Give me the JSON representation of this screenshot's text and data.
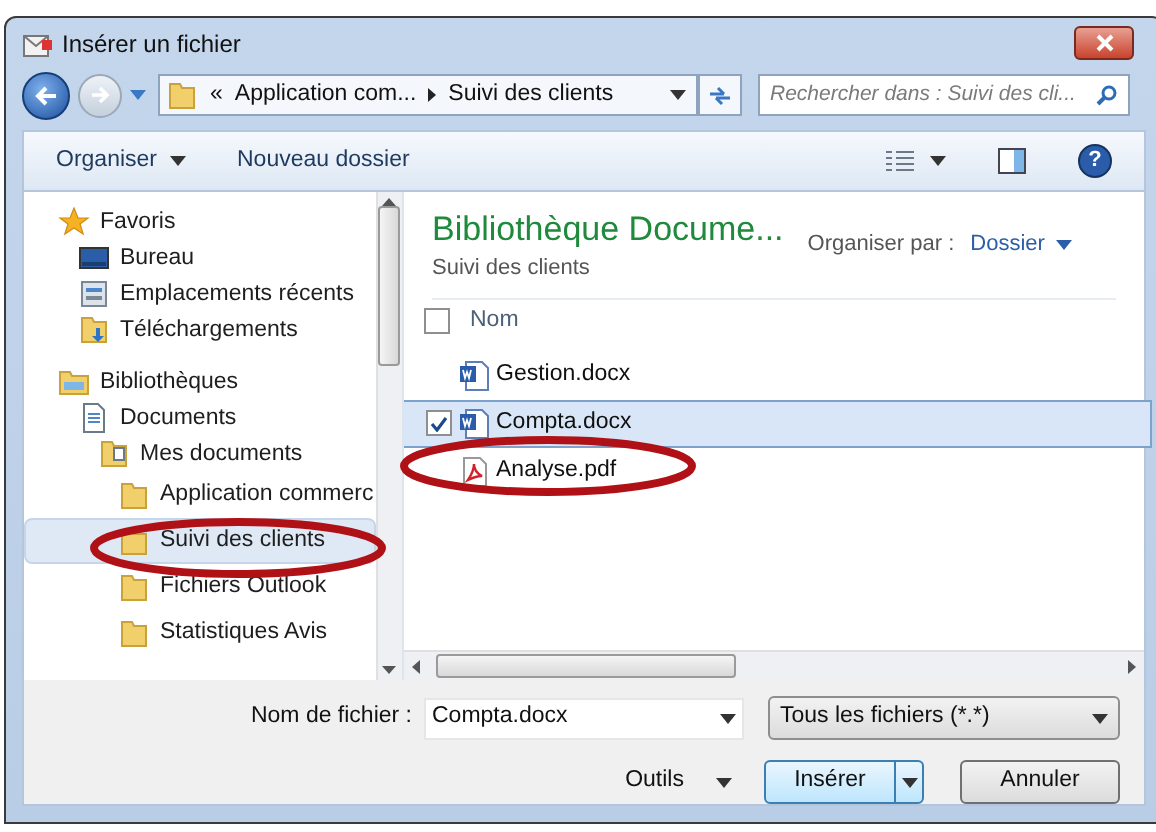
{
  "window": {
    "title": "Insérer un fichier"
  },
  "address_bar": {
    "segments": [
      "«",
      "Application com...",
      "Suivi des clients"
    ]
  },
  "search": {
    "placeholder": "Rechercher dans : Suivi des cli..."
  },
  "toolbar": {
    "items": [
      "Organiser",
      "Nouveau dossier"
    ],
    "help": "?"
  },
  "nav": [
    {
      "label": "Favoris",
      "kind": "star",
      "selected": false,
      "children": [
        {
          "label": "Bureau",
          "kind": "desktop",
          "selected": false
        },
        {
          "label": "Emplacements récents",
          "kind": "recent",
          "selected": false
        },
        {
          "label": "Téléchargements",
          "kind": "download",
          "selected": false
        }
      ]
    },
    {
      "label": "Bibliothèques",
      "kind": "library",
      "selected": false,
      "children": [
        {
          "label": "Documents",
          "kind": "document",
          "selected": false,
          "children": [
            {
              "label": "Mes documents",
              "kind": "docfolder",
              "selected": false,
              "children": [
                {
                  "label": "Application commerc",
                  "kind": "folder",
                  "selected": false
                },
                {
                  "label": "Suivi des clients",
                  "kind": "folder",
                  "selected": true
                },
                {
                  "label": "Fichiers Outlook",
                  "kind": "folder",
                  "selected": false
                },
                {
                  "label": "Statistiques Avis",
                  "kind": "folder",
                  "selected": false
                }
              ]
            }
          ]
        }
      ]
    }
  ],
  "library": {
    "title": "Bibliothèque Docume...",
    "subtitle": "Suivi des clients",
    "arrange_label": "Organiser par :",
    "arrange_value": "Dossier"
  },
  "files": {
    "column": "Nom",
    "header_checked": false,
    "rows": [
      {
        "name": "Gestion.docx",
        "kind": "word",
        "selected": false,
        "checked": false
      },
      {
        "name": "Compta.docx",
        "kind": "word",
        "selected": true,
        "checked": true
      },
      {
        "name": "Analyse.pdf",
        "kind": "pdf",
        "selected": false,
        "checked": false
      }
    ]
  },
  "footer": {
    "filename_label": "Nom de fichier :",
    "filename": "Compta.docx",
    "filetype": "Tous les fichiers (*.*)",
    "tools": "Outils",
    "buttons": [
      {
        "label": "Insérer",
        "kind": "split"
      },
      {
        "label": "Annuler",
        "kind": "plain"
      }
    ]
  }
}
